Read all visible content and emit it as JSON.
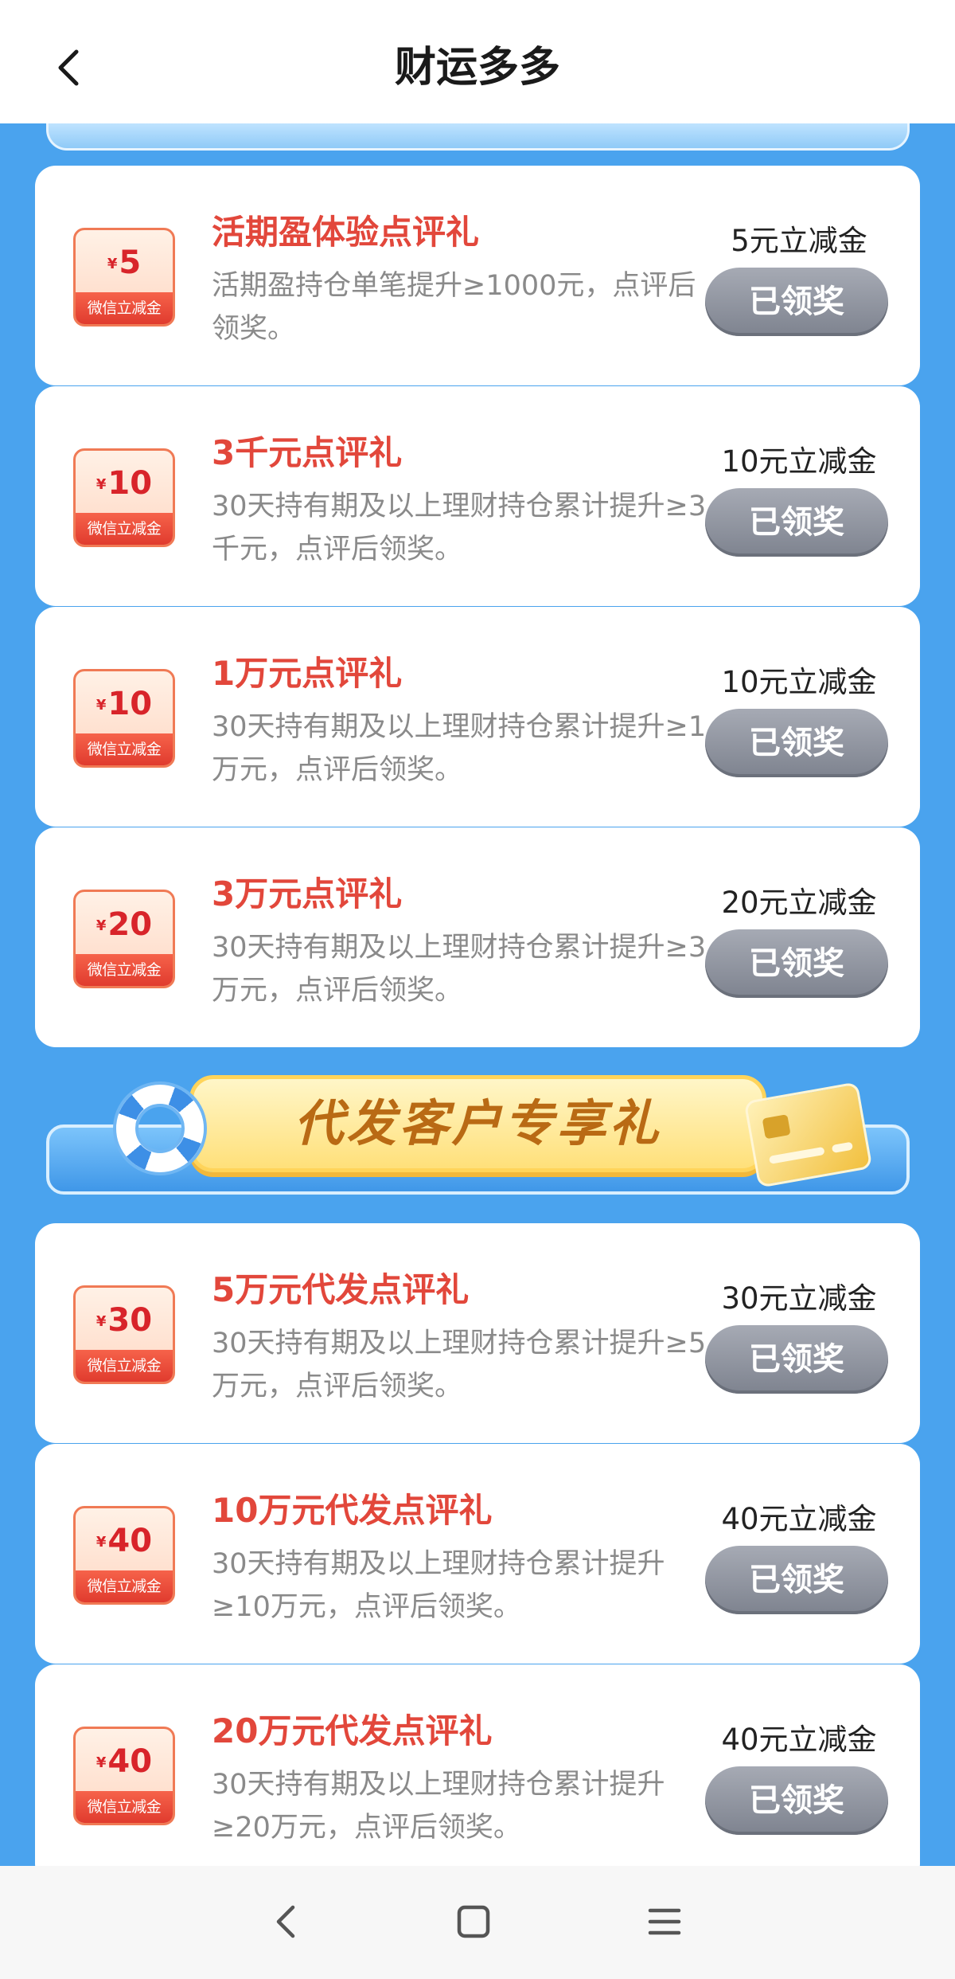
{
  "header": {
    "title": "财运多多",
    "back_icon": "chevron-left-icon"
  },
  "banner": {
    "text": "代发客户专享礼"
  },
  "coupon_label": "微信立减金",
  "currency_symbol": "¥",
  "rewards": [
    {
      "coupon_amount": "5",
      "title": "活期盈体验点评礼",
      "desc": "活期盈持仓单笔提升≥1000元，点评后领奖。",
      "reward": "5元立减金",
      "button": "已领奖"
    },
    {
      "coupon_amount": "10",
      "title": "3千元点评礼",
      "desc": "30天持有期及以上理财持仓累计提升≥3千元，点评后领奖。",
      "reward": "10元立减金",
      "button": "已领奖"
    },
    {
      "coupon_amount": "10",
      "title": "1万元点评礼",
      "desc": "30天持有期及以上理财持仓累计提升≥1万元，点评后领奖。",
      "reward": "10元立减金",
      "button": "已领奖"
    },
    {
      "coupon_amount": "20",
      "title": "3万元点评礼",
      "desc": "30天持有期及以上理财持仓累计提升≥3万元，点评后领奖。",
      "reward": "20元立减金",
      "button": "已领奖"
    },
    {
      "coupon_amount": "30",
      "title": "5万元代发点评礼",
      "desc": "30天持有期及以上理财持仓累计提升≥5万元，点评后领奖。",
      "reward": "30元立减金",
      "button": "已领奖"
    },
    {
      "coupon_amount": "40",
      "title": "10万元代发点评礼",
      "desc": "30天持有期及以上理财持仓累计提升≥10万元，点评后领奖。",
      "reward": "40元立减金",
      "button": "已领奖"
    },
    {
      "coupon_amount": "40",
      "title": "20万元代发点评礼",
      "desc": "30天持有期及以上理财持仓累计提升≥20万元，点评后领奖。",
      "reward": "40元立减金",
      "button": "已领奖"
    }
  ],
  "navbar": {
    "icons": [
      "back-icon",
      "home-square-icon",
      "menu-icon"
    ]
  },
  "colors": {
    "page_background": "#4aa3ee",
    "title_red": "#e2473b",
    "button_gray": "#8e929d",
    "banner_text": "#b96a14"
  }
}
